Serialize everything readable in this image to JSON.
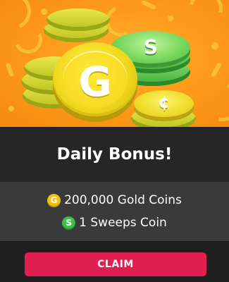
{
  "title": "Daily Bonus!",
  "rewards": [
    {
      "icon": "gold-coin-icon",
      "icon_letter": "G",
      "text": "200,000 Gold Coins"
    },
    {
      "icon": "sweeps-coin-icon",
      "icon_letter": "S",
      "text": "1 Sweeps Coin"
    }
  ],
  "hero": {
    "gold_coin_glyph": "G",
    "sweeps_coin_glyph": "S",
    "side_coin_glyph": "¢"
  },
  "claim_label": "CLAIM",
  "colors": {
    "accent": "#e01e4f",
    "gold": "#f2c10c",
    "green": "#3fc04a",
    "hero_bg": "#ff9b1a"
  }
}
